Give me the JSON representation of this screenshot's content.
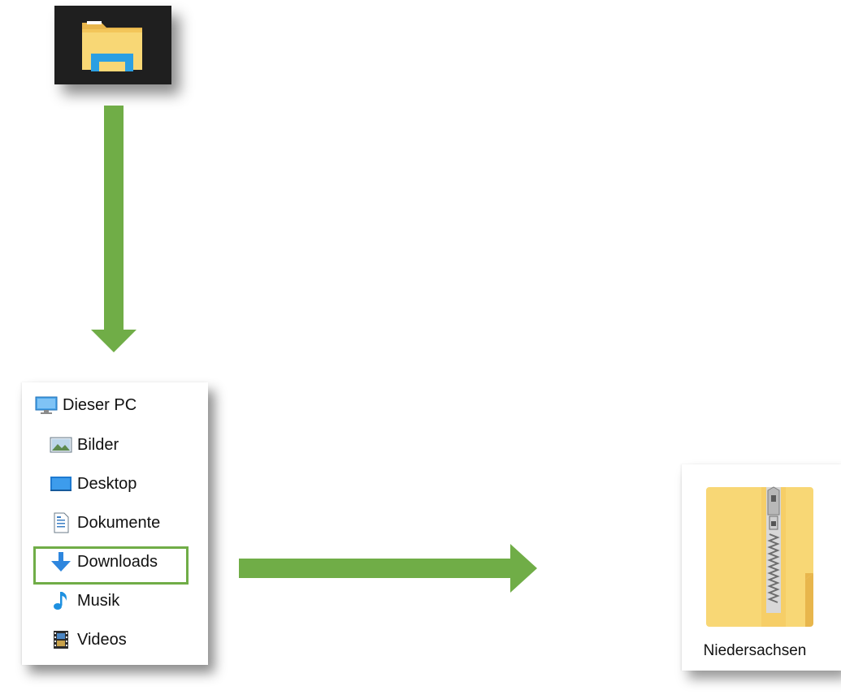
{
  "taskbar": {
    "icon": "file-explorer-icon"
  },
  "nav_pane": {
    "items": [
      {
        "label": "Dieser PC",
        "icon": "this-pc-icon"
      },
      {
        "label": "Bilder",
        "icon": "pictures-icon"
      },
      {
        "label": "Desktop",
        "icon": "desktop-icon"
      },
      {
        "label": "Dokumente",
        "icon": "documents-icon"
      },
      {
        "label": "Downloads",
        "icon": "downloads-icon",
        "highlighted": true
      },
      {
        "label": "Musik",
        "icon": "music-icon"
      },
      {
        "label": "Videos",
        "icon": "videos-icon"
      }
    ]
  },
  "zip_file": {
    "name": "Niedersachsen",
    "icon": "zip-folder-icon"
  },
  "colors": {
    "arrow": "#70ad47",
    "highlight": "#70ad47",
    "folder": "#f8d775",
    "taskbar_bg": "#1f1f1f"
  }
}
